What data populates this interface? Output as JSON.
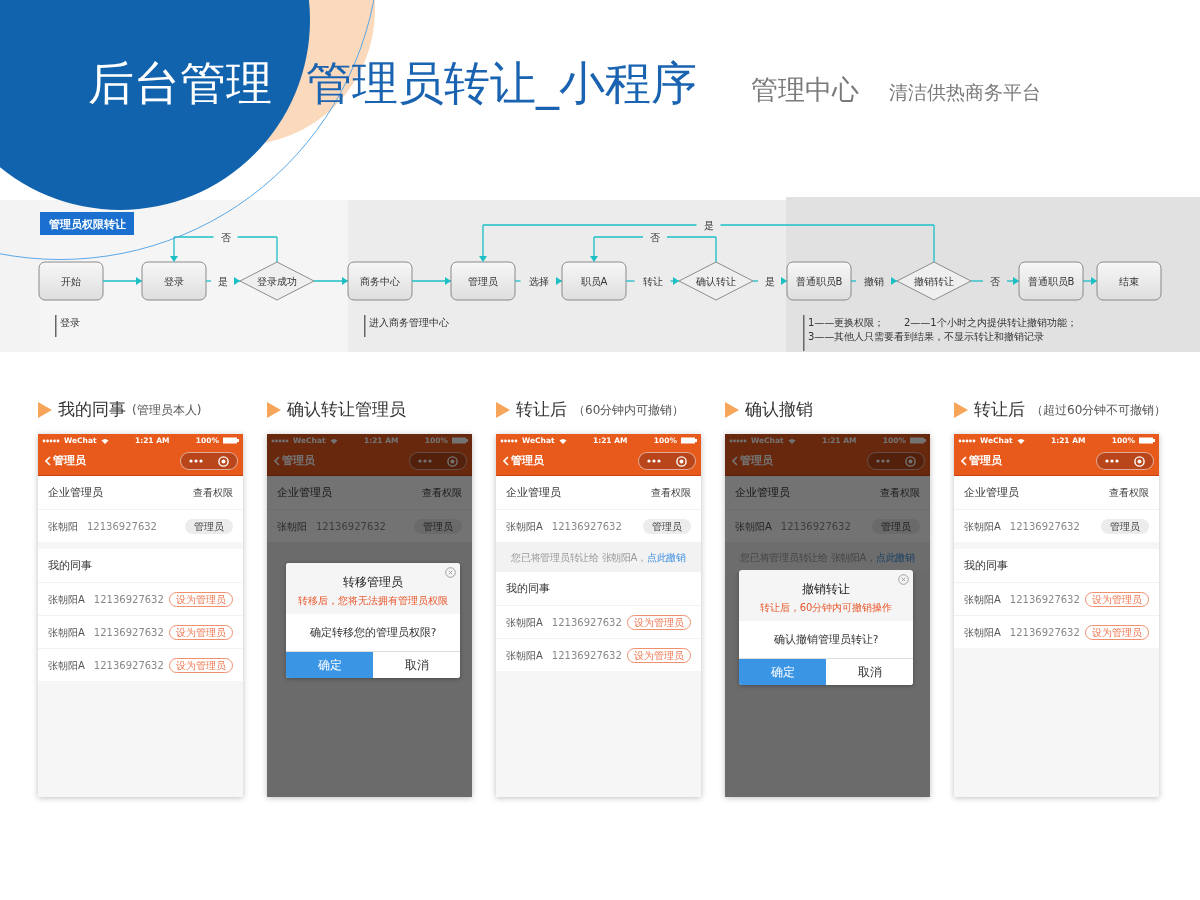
{
  "header": {
    "title": "后台管理",
    "subtitle": "管理员转让_小程序",
    "section": "管理中心",
    "platform": "清洁供热商务平台"
  },
  "flow": {
    "tag": "管理员权限转让",
    "steps": [
      {
        "label": "开始",
        "kind": "process"
      },
      {
        "label": "登录",
        "kind": "process"
      },
      {
        "label": "登录成功",
        "kind": "decision",
        "edge_label": "是"
      },
      {
        "label": "商务中心",
        "kind": "process"
      },
      {
        "label": "管理员",
        "kind": "process"
      },
      {
        "label": "职员A",
        "kind": "process",
        "edge_label": "选择"
      },
      {
        "label": "确认转让",
        "kind": "decision",
        "edge_label": "转让"
      },
      {
        "label": "普通职员B",
        "kind": "process",
        "edge_label": "是"
      },
      {
        "label": "撤销转让",
        "kind": "decision",
        "edge_label": "撤销"
      },
      {
        "label": "普通职员B",
        "kind": "process",
        "edge_label": "否"
      },
      {
        "label": "结束",
        "kind": "process"
      }
    ],
    "loops": [
      {
        "label": "否"
      },
      {
        "label": "否"
      },
      {
        "label": "是"
      }
    ],
    "notes": [
      {
        "lines": [
          [
            "登录"
          ]
        ]
      },
      {
        "lines": [
          [
            "进入商务管理中心"
          ]
        ]
      },
      {
        "lines": [
          [
            "1——更换权限；",
            "2——1个小时之内提供转让撤销功能；"
          ],
          [
            "3——其他人只需要看到结果，不显示转让和撤销记录"
          ]
        ]
      }
    ]
  },
  "phones": [
    {
      "caption": "我的同事",
      "caption_note": "(管理员本人)",
      "carrier": "WeChat",
      "time": "1:21 AM",
      "battery": "100%",
      "nav_title": "管理员",
      "dimmed": false,
      "company_label": "企业管理员",
      "view_link": "查看权限",
      "admin": {
        "name": "张朝阳",
        "phone": "12136927632",
        "badge": "管理员"
      },
      "colleagues_title": "我的同事",
      "colleagues": [
        {
          "name": "张朝阳A",
          "phone": "12136927632",
          "action": "设为管理员"
        },
        {
          "name": "张朝阳A",
          "phone": "12136927632",
          "action": "设为管理员"
        },
        {
          "name": "张朝阳A",
          "phone": "12136927632",
          "action": "设为管理员"
        }
      ]
    },
    {
      "caption": "确认转让管理员",
      "carrier": "WeChat",
      "time": "1:21 AM",
      "battery": "100%",
      "nav_title": "管理员",
      "dimmed": true,
      "company_label": "企业管理员",
      "view_link": "查看权限",
      "admin": {
        "name": "张朝阳",
        "phone": "12136927632",
        "badge": "管理员"
      },
      "dialog": {
        "title": "转移管理员",
        "warning": "转移后，您将无法拥有管理员权限",
        "question": "确定转移您的管理员权限?",
        "confirm": "确定",
        "cancel": "取消"
      }
    },
    {
      "caption": "转让后",
      "caption_note": "（60分钟内可撤销）",
      "carrier": "WeChat",
      "time": "1:21 AM",
      "battery": "100%",
      "nav_title": "管理员",
      "dimmed": false,
      "company_label": "企业管理员",
      "view_link": "查看权限",
      "admin": {
        "name": "张朝阳A",
        "phone": "12136927632",
        "badge": "管理员"
      },
      "notice": {
        "text": "您已将管理员转让给 张朝阳A，",
        "link": "点此撤销"
      },
      "colleagues_title": "我的同事",
      "colleagues": [
        {
          "name": "张朝阳A",
          "phone": "12136927632",
          "action": "设为管理员"
        },
        {
          "name": "张朝阳A",
          "phone": "12136927632",
          "action": "设为管理员"
        }
      ]
    },
    {
      "caption": "确认撤销",
      "carrier": "WeChat",
      "time": "1:21 AM",
      "battery": "100%",
      "nav_title": "管理员",
      "dimmed": true,
      "company_label": "企业管理员",
      "view_link": "查看权限",
      "admin": {
        "name": "张朝阳A",
        "phone": "12136927632",
        "badge": "管理员"
      },
      "notice": {
        "text": "您已将管理员转让给 张朝阳A，",
        "link": "点此撤销"
      },
      "dialog": {
        "title": "撤销转让",
        "warning": "转让后，60分钟内可撤销操作",
        "question": "确认撤销管理员转让?",
        "confirm": "确定",
        "cancel": "取消"
      }
    },
    {
      "caption": "转让后",
      "caption_note": "（超过60分钟不可撤销）",
      "carrier": "WeChat",
      "time": "1:21 AM",
      "battery": "100%",
      "nav_title": "管理员",
      "dimmed": false,
      "company_label": "企业管理员",
      "view_link": "查看权限",
      "admin": {
        "name": "张朝阳A",
        "phone": "12136927632",
        "badge": "管理员"
      },
      "colleagues_title": "我的同事",
      "colleagues": [
        {
          "name": "张朝阳A",
          "phone": "12136927632",
          "action": "设为管理员"
        },
        {
          "name": "张朝阳A",
          "phone": "12136927632",
          "action": "设为管理员"
        }
      ]
    }
  ]
}
